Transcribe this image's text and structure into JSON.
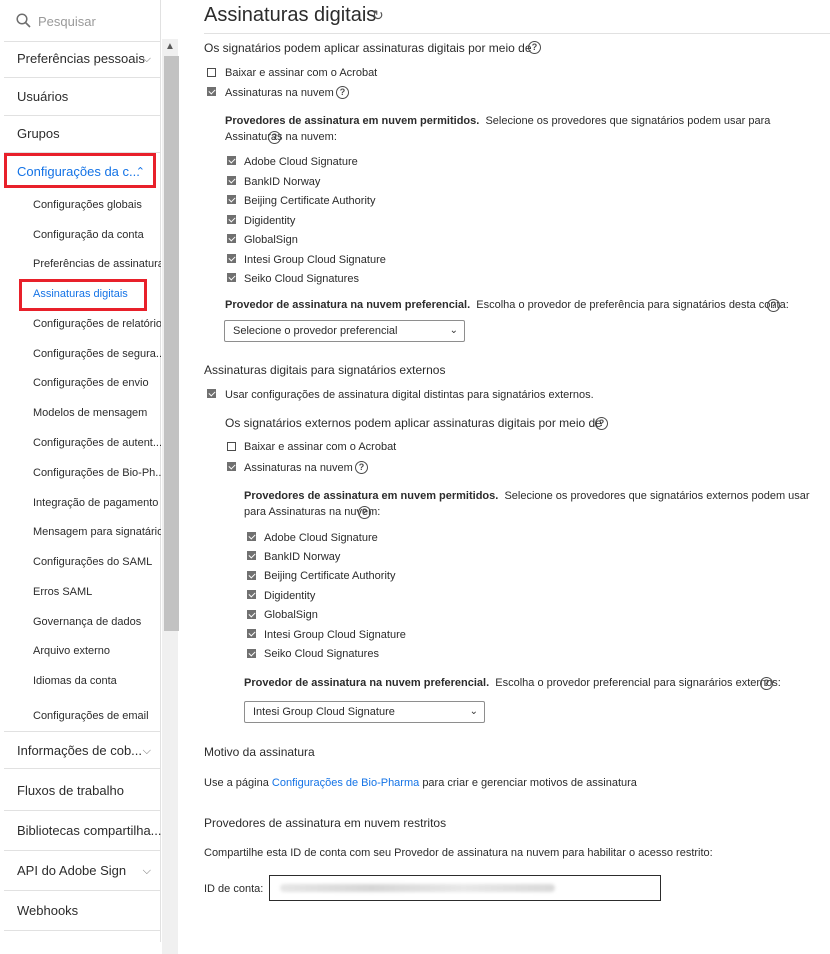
{
  "sidebar": {
    "search_placeholder": "Pesquisar",
    "top_items": [
      {
        "label": "Preferências pessoais",
        "chevron": "⌵"
      },
      {
        "label": "Usuários"
      },
      {
        "label": "Grupos"
      },
      {
        "label": "Configurações da c...",
        "chevron": "⌃"
      }
    ],
    "sub_items": [
      "Configurações globais",
      "Configuração da conta",
      "Preferências de assinatura",
      "Assinaturas digitais",
      "Configurações de relatório",
      "Configurações de segura...",
      "Configurações de envio",
      "Modelos de mensagem",
      "Configurações de autent...",
      "Configurações de Bio-Ph...",
      "Integração de pagamento",
      "Mensagem para signatário",
      "Configurações do SAML",
      "Erros SAML",
      "Governança de dados",
      "Arquivo externo",
      "Idiomas da conta",
      "Configurações de email"
    ],
    "bottom_items": [
      {
        "label": "Informações de cob...",
        "chevron": "⌵"
      },
      {
        "label": "Fluxos de trabalho"
      },
      {
        "label": "Bibliotecas compartilha..."
      },
      {
        "label": "API do Adobe Sign",
        "chevron": "⌵"
      },
      {
        "label": "Webhooks"
      }
    ],
    "scroll_up_glyph": "▲"
  },
  "main": {
    "title": "Assinaturas digitais",
    "refresh_glyph": "↻",
    "section1": {
      "heading": "Os signatários podem aplicar assinaturas digitais por meio de",
      "opt_download": "Baixar e assinar com o Acrobat",
      "opt_cloud": "Assinaturas na nuvem",
      "providers_bold": "Provedores de assinatura em nuvem permitidos.",
      "providers_text": "Selecione os provedores que signatários podem usar para Assinaturas na nuvem:",
      "providers": [
        "Adobe Cloud Signature",
        "BankID Norway",
        "Beijing Certificate Authority",
        "Digidentity",
        "GlobalSign",
        "Intesi Group Cloud Signature",
        "Seiko Cloud Signatures"
      ],
      "preferred_bold": "Provedor de assinatura na nuvem preferencial.",
      "preferred_text": "Escolha o provedor de preferência para signatários desta conta:",
      "preferred_value": "Selecione o provedor preferencial"
    },
    "section2": {
      "heading": "Assinaturas digitais para signatários externos",
      "use_distinct": "Usar configurações de assinatura digital distintas para signatários externos.",
      "subheading": "Os signatários externos podem aplicar assinaturas digitais por meio de",
      "opt_download": "Baixar e assinar com o Acrobat",
      "opt_cloud": "Assinaturas na nuvem",
      "providers_bold": "Provedores de assinatura em nuvem permitidos.",
      "providers_text": "Selecione os provedores que signatários externos podem usar para Assinaturas na nuvem:",
      "providers": [
        "Adobe Cloud Signature",
        "BankID Norway",
        "Beijing Certificate Authority",
        "Digidentity",
        "GlobalSign",
        "Intesi Group Cloud Signature",
        "Seiko Cloud Signatures"
      ],
      "preferred_bold": "Provedor de assinatura na nuvem preferencial.",
      "preferred_text": "Escolha o provedor preferencial para signarários externos:",
      "preferred_value": "Intesi Group Cloud Signature"
    },
    "reason": {
      "heading": "Motivo da assinatura",
      "text_before": "Use a página",
      "link": "Configurações de Bio-Pharma",
      "text_after": "para criar e gerenciar motivos de assinatura"
    },
    "restricted": {
      "heading": "Provedores de assinatura em nuvem restritos",
      "text": "Compartilhe esta ID de conta com seu Provedor de assinatura na nuvem para habilitar o acesso restrito:",
      "account_label": "ID de conta:"
    },
    "help_glyph": "?",
    "dropdown_glyph": "⌄"
  },
  "colors": {
    "accent": "#1473e6",
    "highlight": "#e8202a",
    "checkbox": "#707070"
  }
}
